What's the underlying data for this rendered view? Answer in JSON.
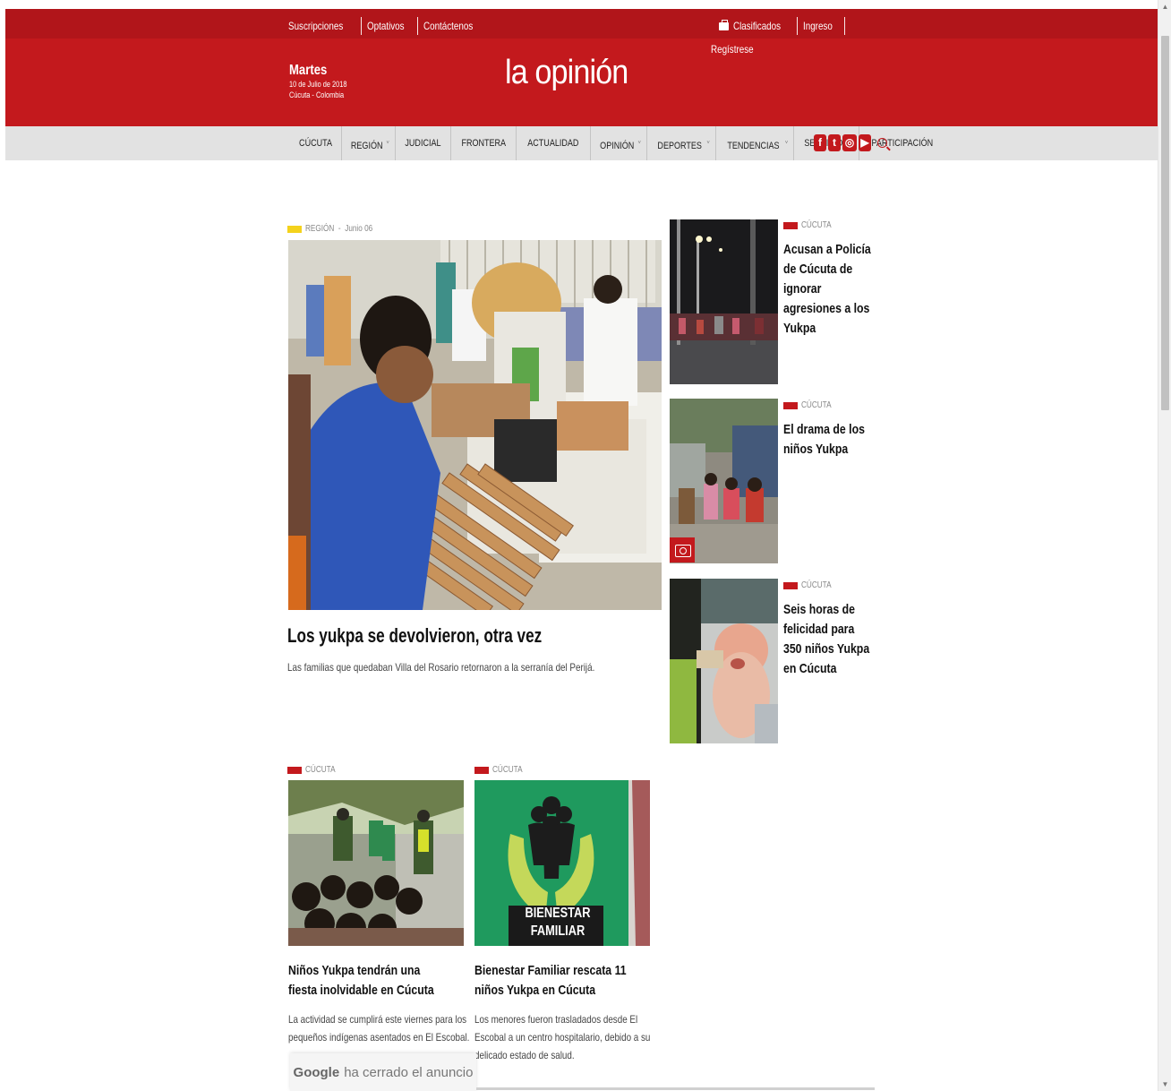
{
  "topbar": {
    "links": [
      "Suscripciones",
      "Optativos",
      "Contáctenos"
    ],
    "right_links": [
      "Clasificados",
      "Ingreso"
    ],
    "register": "Regístrese"
  },
  "date": {
    "day": "Martes",
    "full": "10 de Julio de 2018",
    "place": "Cúcuta - Colombia"
  },
  "logo": "la opinión",
  "nav": [
    "CÚCUTA",
    "REGIÓN",
    "JUDICIAL",
    "FRONTERA",
    "ACTUALIDAD",
    "OPINIÓN",
    "DEPORTES",
    "TENDENCIAS",
    "SERVICIOS",
    "PARTICIPACIÓN"
  ],
  "social_icons": [
    "facebook-icon",
    "twitter-icon",
    "instagram-icon",
    "youtube-icon",
    "search-icon"
  ],
  "featured": {
    "category": "REGIÓN",
    "separator": "-",
    "date": "Junio 06",
    "title": "Los yukpa se devolvieron, otra vez",
    "summary": "Las  familias que quedaban Villa del Rosario retornaron a la serranía del Perijá."
  },
  "side_stories": [
    {
      "category": "CÚCUTA",
      "title": "Acusan a Policía de Cúcuta de ignorar agresiones a los Yukpa"
    },
    {
      "category": "CÚCUTA",
      "title": "El drama de los niños Yukpa"
    },
    {
      "category": "CÚCUTA",
      "title": "Seis horas de felicidad para 350 niños Yukpa en Cúcuta"
    }
  ],
  "cards": [
    {
      "category": "CÚCUTA",
      "title": "Niños Yukpa tendrán una fiesta inolvidable en Cúcuta",
      "summary": "La actividad se cumplirá este viernes para los pequeños indígenas asentados en El Escobal."
    },
    {
      "category": "CÚCUTA",
      "title": "Bienestar Familiar rescata 11 niños Yukpa en Cúcuta",
      "summary": "Los menores fueron trasladados desde El Escobal a un centro hospitalario, debido a su delicado estado de salud."
    }
  ],
  "bienestar_sign": [
    "BIENESTAR",
    "FAMILIAR"
  ],
  "ad": {
    "brand": "Google",
    "text": "ha cerrado el anuncio"
  },
  "colors": {
    "brand_red": "#c3191d",
    "region_tag": "#f4d21c",
    "nav_bg": "#e2e2e2"
  }
}
